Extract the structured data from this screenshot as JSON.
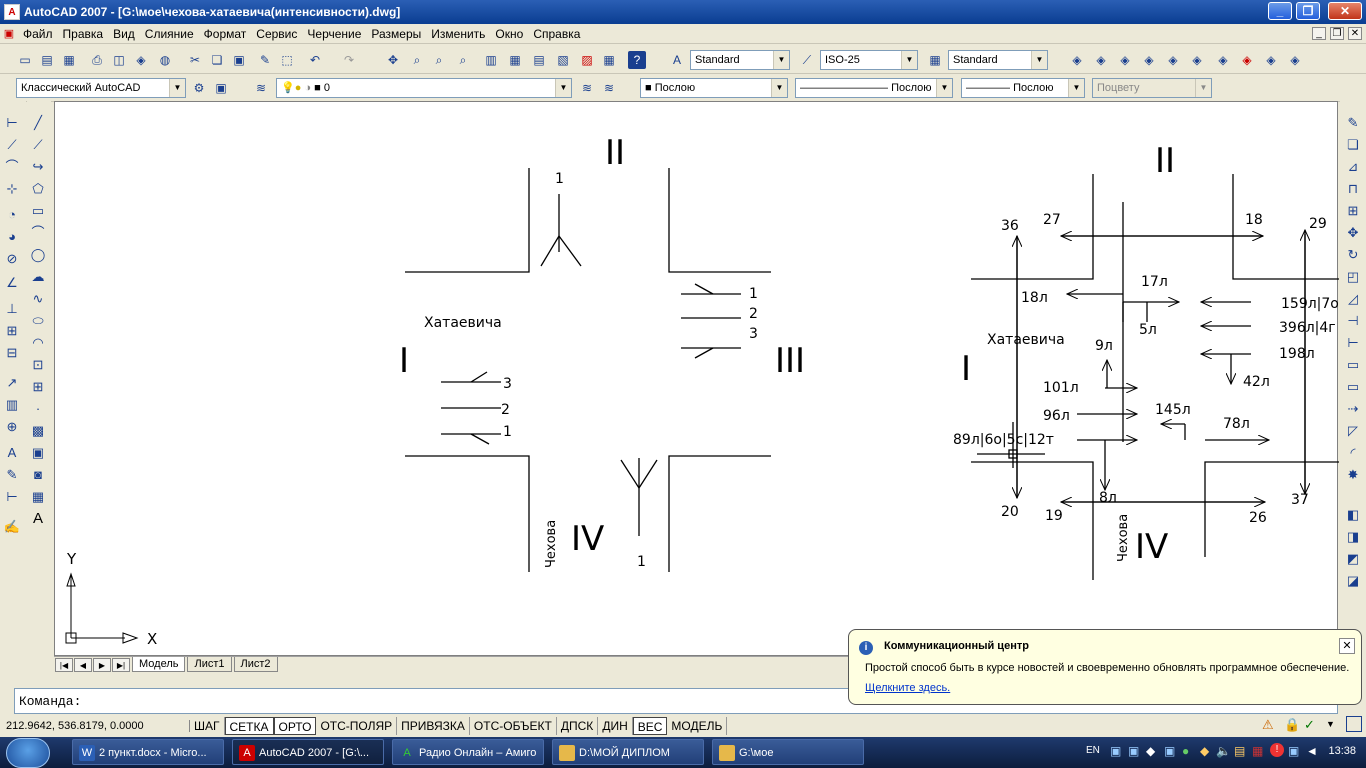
{
  "window": {
    "title": "AutoCAD 2007 - [G:\\мое\\чехова-хатаевича(интенсивности).dwg]",
    "app_icon": "autocad-logo"
  },
  "menu": [
    "Файл",
    "Правка",
    "Вид",
    "Слияние",
    "Формат",
    "Сервис",
    "Черчение",
    "Размеры",
    "Изменить",
    "Окно",
    "Справка"
  ],
  "toolbar": {
    "text_style": "Standard",
    "dim_style": "ISO-25",
    "table_style": "Standard",
    "workspace": "Классический AutoCAD",
    "layer": "0",
    "color": "Послою",
    "linetype": "Послою",
    "lineweight": "Послою",
    "plotstyle": "Поцвету"
  },
  "drawing": {
    "left_intersection": {
      "dir_I": "I",
      "dir_II": "II",
      "dir_III": "III",
      "dir_IV": "IV",
      "street_h": "Хатаевича",
      "street_v": "Чехова",
      "lane_top": "1",
      "lane_bottom": "1",
      "lanes_right": [
        "1",
        "2",
        "3"
      ],
      "lanes_left": [
        "3",
        "2",
        "1"
      ]
    },
    "right_intersection": {
      "dir_I": "I",
      "dir_II": "II",
      "dir_IV": "IV",
      "street_h": "Хатаевича",
      "street_v": "Чехова",
      "values": {
        "v36": "36",
        "v27": "27",
        "v18": "18",
        "v29": "29",
        "v18l": "18л",
        "v17l": "17л",
        "v5l": "5л",
        "v159": "159л|7о",
        "v396": "396л|4г",
        "v198": "198л",
        "v42l": "42л",
        "v9l": "9л",
        "v101": "101л",
        "v96": "96л",
        "v89": "89л|6о|5с|12т",
        "v145": "145л",
        "v78": "78л",
        "v8l": "8л",
        "v20": "20",
        "v19": "19",
        "v26": "26",
        "v37": "37"
      }
    },
    "ucs": {
      "y": "Y",
      "x": "X"
    }
  },
  "tabs": [
    "Модель",
    "Лист1",
    "Лист2"
  ],
  "command": {
    "prompt": "Команда:"
  },
  "status": {
    "coords": "212.9642, 536.8179, 0.0000",
    "buttons": [
      "ШАГ",
      "СЕТКА",
      "ОРТО",
      "ОТС-ПОЛЯР",
      "ПРИВЯЗКА",
      "ОТС-ОБЪЕКТ",
      "ДПСК",
      "ДИН",
      "ВЕС",
      "МОДЕЛЬ"
    ]
  },
  "balloon": {
    "title": "Коммуникационный центр",
    "text": "Простой способ быть в курсе новостей и своевременно обновлять программное обеспечение.",
    "link": "Щелкните здесь."
  },
  "taskbar": {
    "tasks": [
      "2 пункт.docx - Micro...",
      "AutoCAD 2007 - [G:\\...",
      "Радио Онлайн – Амиго",
      "D:\\МОЙ ДИПЛОМ",
      "G:\\мое"
    ],
    "lang": "EN",
    "clock": "13:38"
  }
}
